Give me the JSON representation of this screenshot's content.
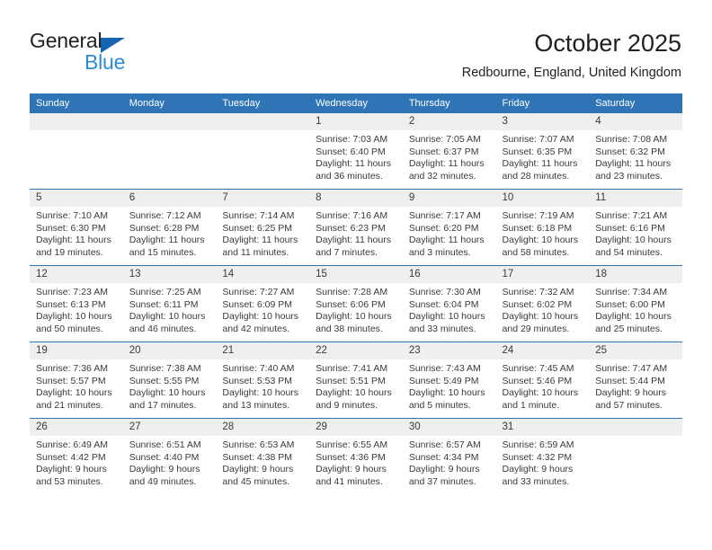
{
  "brand": {
    "name_part1": "General",
    "name_part2": "Blue",
    "triangle_icon": "triangle-icon",
    "accent_color": "#1565b0",
    "accent_color_light": "#2a8bd5"
  },
  "header": {
    "title": "October 2025",
    "subtitle": "Redbourne, England, United Kingdom"
  },
  "theme": {
    "header_bg": "#2f74b5",
    "daynum_bg": "#efefef",
    "text": "#3a3a3a"
  },
  "weekdays": [
    "Sunday",
    "Monday",
    "Tuesday",
    "Wednesday",
    "Thursday",
    "Friday",
    "Saturday"
  ],
  "labels": {
    "sunrise_prefix": "Sunrise:",
    "sunset_prefix": "Sunset:",
    "daylight_prefix": "Daylight:"
  },
  "weeks": [
    [
      {
        "day": "",
        "sunrise": "",
        "sunset": "",
        "daylight_line1": "",
        "daylight_line2": ""
      },
      {
        "day": "",
        "sunrise": "",
        "sunset": "",
        "daylight_line1": "",
        "daylight_line2": ""
      },
      {
        "day": "",
        "sunrise": "",
        "sunset": "",
        "daylight_line1": "",
        "daylight_line2": ""
      },
      {
        "day": "1",
        "sunrise": "Sunrise: 7:03 AM",
        "sunset": "Sunset: 6:40 PM",
        "daylight_line1": "Daylight: 11 hours",
        "daylight_line2": "and 36 minutes."
      },
      {
        "day": "2",
        "sunrise": "Sunrise: 7:05 AM",
        "sunset": "Sunset: 6:37 PM",
        "daylight_line1": "Daylight: 11 hours",
        "daylight_line2": "and 32 minutes."
      },
      {
        "day": "3",
        "sunrise": "Sunrise: 7:07 AM",
        "sunset": "Sunset: 6:35 PM",
        "daylight_line1": "Daylight: 11 hours",
        "daylight_line2": "and 28 minutes."
      },
      {
        "day": "4",
        "sunrise": "Sunrise: 7:08 AM",
        "sunset": "Sunset: 6:32 PM",
        "daylight_line1": "Daylight: 11 hours",
        "daylight_line2": "and 23 minutes."
      }
    ],
    [
      {
        "day": "5",
        "sunrise": "Sunrise: 7:10 AM",
        "sunset": "Sunset: 6:30 PM",
        "daylight_line1": "Daylight: 11 hours",
        "daylight_line2": "and 19 minutes."
      },
      {
        "day": "6",
        "sunrise": "Sunrise: 7:12 AM",
        "sunset": "Sunset: 6:28 PM",
        "daylight_line1": "Daylight: 11 hours",
        "daylight_line2": "and 15 minutes."
      },
      {
        "day": "7",
        "sunrise": "Sunrise: 7:14 AM",
        "sunset": "Sunset: 6:25 PM",
        "daylight_line1": "Daylight: 11 hours",
        "daylight_line2": "and 11 minutes."
      },
      {
        "day": "8",
        "sunrise": "Sunrise: 7:16 AM",
        "sunset": "Sunset: 6:23 PM",
        "daylight_line1": "Daylight: 11 hours",
        "daylight_line2": "and 7 minutes."
      },
      {
        "day": "9",
        "sunrise": "Sunrise: 7:17 AM",
        "sunset": "Sunset: 6:20 PM",
        "daylight_line1": "Daylight: 11 hours",
        "daylight_line2": "and 3 minutes."
      },
      {
        "day": "10",
        "sunrise": "Sunrise: 7:19 AM",
        "sunset": "Sunset: 6:18 PM",
        "daylight_line1": "Daylight: 10 hours",
        "daylight_line2": "and 58 minutes."
      },
      {
        "day": "11",
        "sunrise": "Sunrise: 7:21 AM",
        "sunset": "Sunset: 6:16 PM",
        "daylight_line1": "Daylight: 10 hours",
        "daylight_line2": "and 54 minutes."
      }
    ],
    [
      {
        "day": "12",
        "sunrise": "Sunrise: 7:23 AM",
        "sunset": "Sunset: 6:13 PM",
        "daylight_line1": "Daylight: 10 hours",
        "daylight_line2": "and 50 minutes."
      },
      {
        "day": "13",
        "sunrise": "Sunrise: 7:25 AM",
        "sunset": "Sunset: 6:11 PM",
        "daylight_line1": "Daylight: 10 hours",
        "daylight_line2": "and 46 minutes."
      },
      {
        "day": "14",
        "sunrise": "Sunrise: 7:27 AM",
        "sunset": "Sunset: 6:09 PM",
        "daylight_line1": "Daylight: 10 hours",
        "daylight_line2": "and 42 minutes."
      },
      {
        "day": "15",
        "sunrise": "Sunrise: 7:28 AM",
        "sunset": "Sunset: 6:06 PM",
        "daylight_line1": "Daylight: 10 hours",
        "daylight_line2": "and 38 minutes."
      },
      {
        "day": "16",
        "sunrise": "Sunrise: 7:30 AM",
        "sunset": "Sunset: 6:04 PM",
        "daylight_line1": "Daylight: 10 hours",
        "daylight_line2": "and 33 minutes."
      },
      {
        "day": "17",
        "sunrise": "Sunrise: 7:32 AM",
        "sunset": "Sunset: 6:02 PM",
        "daylight_line1": "Daylight: 10 hours",
        "daylight_line2": "and 29 minutes."
      },
      {
        "day": "18",
        "sunrise": "Sunrise: 7:34 AM",
        "sunset": "Sunset: 6:00 PM",
        "daylight_line1": "Daylight: 10 hours",
        "daylight_line2": "and 25 minutes."
      }
    ],
    [
      {
        "day": "19",
        "sunrise": "Sunrise: 7:36 AM",
        "sunset": "Sunset: 5:57 PM",
        "daylight_line1": "Daylight: 10 hours",
        "daylight_line2": "and 21 minutes."
      },
      {
        "day": "20",
        "sunrise": "Sunrise: 7:38 AM",
        "sunset": "Sunset: 5:55 PM",
        "daylight_line1": "Daylight: 10 hours",
        "daylight_line2": "and 17 minutes."
      },
      {
        "day": "21",
        "sunrise": "Sunrise: 7:40 AM",
        "sunset": "Sunset: 5:53 PM",
        "daylight_line1": "Daylight: 10 hours",
        "daylight_line2": "and 13 minutes."
      },
      {
        "day": "22",
        "sunrise": "Sunrise: 7:41 AM",
        "sunset": "Sunset: 5:51 PM",
        "daylight_line1": "Daylight: 10 hours",
        "daylight_line2": "and 9 minutes."
      },
      {
        "day": "23",
        "sunrise": "Sunrise: 7:43 AM",
        "sunset": "Sunset: 5:49 PM",
        "daylight_line1": "Daylight: 10 hours",
        "daylight_line2": "and 5 minutes."
      },
      {
        "day": "24",
        "sunrise": "Sunrise: 7:45 AM",
        "sunset": "Sunset: 5:46 PM",
        "daylight_line1": "Daylight: 10 hours",
        "daylight_line2": "and 1 minute."
      },
      {
        "day": "25",
        "sunrise": "Sunrise: 7:47 AM",
        "sunset": "Sunset: 5:44 PM",
        "daylight_line1": "Daylight: 9 hours",
        "daylight_line2": "and 57 minutes."
      }
    ],
    [
      {
        "day": "26",
        "sunrise": "Sunrise: 6:49 AM",
        "sunset": "Sunset: 4:42 PM",
        "daylight_line1": "Daylight: 9 hours",
        "daylight_line2": "and 53 minutes."
      },
      {
        "day": "27",
        "sunrise": "Sunrise: 6:51 AM",
        "sunset": "Sunset: 4:40 PM",
        "daylight_line1": "Daylight: 9 hours",
        "daylight_line2": "and 49 minutes."
      },
      {
        "day": "28",
        "sunrise": "Sunrise: 6:53 AM",
        "sunset": "Sunset: 4:38 PM",
        "daylight_line1": "Daylight: 9 hours",
        "daylight_line2": "and 45 minutes."
      },
      {
        "day": "29",
        "sunrise": "Sunrise: 6:55 AM",
        "sunset": "Sunset: 4:36 PM",
        "daylight_line1": "Daylight: 9 hours",
        "daylight_line2": "and 41 minutes."
      },
      {
        "day": "30",
        "sunrise": "Sunrise: 6:57 AM",
        "sunset": "Sunset: 4:34 PM",
        "daylight_line1": "Daylight: 9 hours",
        "daylight_line2": "and 37 minutes."
      },
      {
        "day": "31",
        "sunrise": "Sunrise: 6:59 AM",
        "sunset": "Sunset: 4:32 PM",
        "daylight_line1": "Daylight: 9 hours",
        "daylight_line2": "and 33 minutes."
      },
      {
        "day": "",
        "sunrise": "",
        "sunset": "",
        "daylight_line1": "",
        "daylight_line2": ""
      }
    ]
  ]
}
